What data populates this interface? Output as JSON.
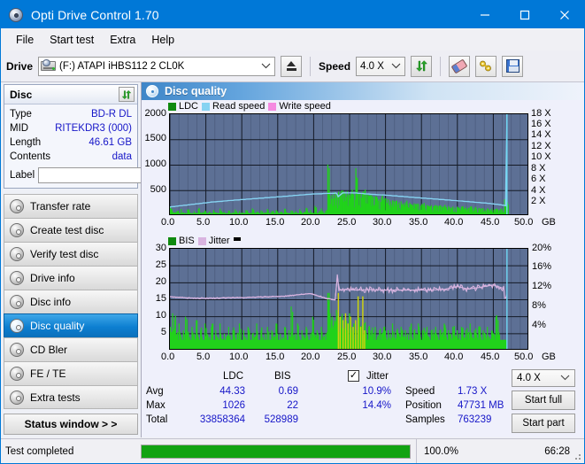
{
  "window": {
    "title": "Opti Drive Control 1.70",
    "icon": "disc-icon",
    "minimize": "–",
    "maximize": "□",
    "close": "✕"
  },
  "menu": {
    "items": [
      {
        "label": "File",
        "name": "menu-file"
      },
      {
        "label": "Start test",
        "name": "menu-start-test"
      },
      {
        "label": "Extra",
        "name": "menu-extra"
      },
      {
        "label": "Help",
        "name": "menu-help"
      }
    ]
  },
  "toolbar": {
    "drive_label": "Drive",
    "drive_value": "(F:)   ATAPI iHBS112  2 CL0K",
    "eject_title": "Eject",
    "speed_label": "Speed",
    "speed_value": "4.0 X",
    "refresh_title": "Refresh",
    "erase_title": "Erase",
    "tools_title": "Tools",
    "save_title": "Save"
  },
  "disc_panel": {
    "title": "Disc",
    "refresh_title": "Refresh disc info",
    "rows": [
      {
        "label": "Type",
        "value": "BD-R DL"
      },
      {
        "label": "MID",
        "value": "RITEKDR3 (000)"
      },
      {
        "label": "Length",
        "value": "46.61 GB"
      },
      {
        "label": "Contents",
        "value": "data"
      }
    ],
    "label_field_label": "Label",
    "label_field_value": "",
    "label_field_placeholder": "",
    "label_button_title": "Disc label"
  },
  "nav": {
    "items": [
      {
        "label": "Transfer rate",
        "name": "sidebar-item-transfer-rate",
        "active": false
      },
      {
        "label": "Create test disc",
        "name": "sidebar-item-create-test-disc",
        "active": false
      },
      {
        "label": "Verify test disc",
        "name": "sidebar-item-verify-test-disc",
        "active": false
      },
      {
        "label": "Drive info",
        "name": "sidebar-item-drive-info",
        "active": false
      },
      {
        "label": "Disc info",
        "name": "sidebar-item-disc-info",
        "active": false
      },
      {
        "label": "Disc quality",
        "name": "sidebar-item-disc-quality",
        "active": true
      },
      {
        "label": "CD Bler",
        "name": "sidebar-item-cd-bler",
        "active": false
      },
      {
        "label": "FE / TE",
        "name": "sidebar-item-fe-te",
        "active": false
      },
      {
        "label": "Extra tests",
        "name": "sidebar-item-extra-tests",
        "active": false
      }
    ],
    "status_window": "Status window > >"
  },
  "content": {
    "title": "Disc quality"
  },
  "stats": {
    "col_ldc": "LDC",
    "col_bis": "BIS",
    "jitter_label": "Jitter",
    "jitter_checked": true,
    "row_avg": "Avg",
    "row_max": "Max",
    "row_total": "Total",
    "ldc_avg": "44.33",
    "ldc_max": "1026",
    "ldc_total": "33858364",
    "bis_avg": "0.69",
    "bis_max": "22",
    "bis_total": "528989",
    "jitter_avg": "10.9%",
    "jitter_max": "14.4%",
    "speed_label": "Speed",
    "speed_value": "1.73 X",
    "position_label": "Position",
    "position_value": "47731 MB",
    "samples_label": "Samples",
    "samples_value": "763239",
    "speed_select": "4.0 X",
    "start_full": "Start full",
    "start_part": "Start part"
  },
  "statusbar": {
    "text": "Test completed",
    "progress_percent": 100.0,
    "percent_label": "100.0%",
    "elapsed": "66:28"
  },
  "colors": {
    "accent": "#0078d7",
    "plot_bg": "#5d7095",
    "grid": "#2b3347",
    "ldc_green": "#21d21b",
    "bis_green": "#21d21b",
    "read_speed": "#86d3f2",
    "write_speed": "#f58be0",
    "jitter": "#d9b4e0",
    "value_blue": "#1616c8",
    "progress_green": "#12a312"
  },
  "chart_data": [
    {
      "type": "area",
      "name": "ldc-chart",
      "title": "",
      "xlabel": "GB",
      "ylabel": "",
      "xlim": [
        0,
        50
      ],
      "ylim": [
        0,
        2000
      ],
      "y2lim": [
        0,
        18
      ],
      "y2label": "X",
      "grid": true,
      "legend": [
        "LDC",
        "Read speed",
        "Write speed"
      ],
      "legend_colors": [
        "#0f8a0f",
        "#86d3f2",
        "#f58be0"
      ],
      "xticks": [
        "0.0",
        "5.0",
        "10.0",
        "15.0",
        "20.0",
        "25.0",
        "30.0",
        "35.0",
        "40.0",
        "45.0",
        "50.0"
      ],
      "yticks": [
        "2000",
        "1500",
        "1000",
        "500"
      ],
      "y2ticks": [
        "18 X",
        "16 X",
        "14 X",
        "12 X",
        "10 X",
        "8 X",
        "6 X",
        "4 X",
        "2 X"
      ],
      "series": [
        {
          "name": "LDC",
          "kind": "bars",
          "x": [
            0.0,
            0.3,
            0.6,
            0.9,
            1.2,
            1.5,
            1.8,
            2.1,
            2.4,
            2.7,
            3.0,
            3.3,
            3.6,
            3.9,
            4.2,
            4.5,
            4.8,
            5.1,
            5.4,
            5.7,
            6.0,
            6.3,
            6.6,
            6.9,
            7.2,
            7.5,
            7.8,
            8.1,
            8.4,
            8.7,
            9.0,
            9.3,
            9.6,
            9.9,
            10.2,
            10.5,
            10.8,
            11.1,
            11.4,
            11.7,
            12.0,
            12.3,
            12.6,
            12.9,
            13.2,
            13.5,
            13.8,
            14.1,
            14.4,
            14.7,
            15.0,
            15.3,
            15.6,
            15.9,
            16.2,
            16.5,
            16.8,
            17.1,
            17.4,
            17.7,
            18.0,
            18.3,
            18.6,
            18.9,
            19.2,
            19.5,
            19.8,
            20.1,
            20.4,
            20.7,
            21.0,
            21.3,
            21.6,
            21.9,
            22.2,
            22.5,
            22.8,
            23.1,
            23.4,
            23.7,
            24.0,
            24.3,
            24.6,
            24.9,
            25.2,
            25.5,
            25.8,
            26.1,
            26.4,
            26.7,
            27.0,
            27.3,
            27.6,
            27.9,
            28.2,
            28.5,
            28.8,
            29.1,
            29.4,
            29.7,
            30.0,
            30.3,
            30.6,
            30.9,
            31.2,
            31.5,
            31.8,
            32.1,
            32.4,
            32.7,
            33.0,
            33.3,
            33.6,
            33.9,
            34.2,
            34.5,
            34.8,
            35.1,
            35.4,
            35.7,
            36.0,
            36.3,
            36.6,
            36.9,
            37.2,
            37.5,
            37.8,
            38.1,
            38.4,
            38.7,
            39.0,
            39.3,
            39.6,
            39.9,
            40.2,
            40.5,
            40.8,
            41.1,
            41.4,
            41.7,
            42.0,
            42.3,
            42.6,
            42.9,
            43.2,
            43.5,
            43.8,
            44.1,
            44.4,
            44.7,
            45.0,
            45.3,
            45.6,
            45.9,
            46.2,
            46.5,
            46.8
          ],
          "values": [
            180,
            90,
            70,
            95,
            60,
            140,
            75,
            60,
            130,
            70,
            55,
            95,
            65,
            140,
            60,
            75,
            110,
            60,
            90,
            55,
            120,
            70,
            60,
            145,
            65,
            80,
            60,
            105,
            55,
            75,
            130,
            60,
            95,
            65,
            55,
            120,
            70,
            60,
            150,
            65,
            85,
            55,
            110,
            60,
            75,
            140,
            60,
            95,
            65,
            120,
            55,
            80,
            60,
            145,
            70,
            60,
            110,
            65,
            90,
            55,
            135,
            60,
            75,
            160,
            65,
            120,
            70,
            200,
            60,
            95,
            150,
            65,
            110,
            1010,
            400,
            420,
            470,
            430,
            480,
            460,
            500,
            440,
            490,
            430,
            470,
            420,
            940,
            430,
            460,
            440,
            480,
            420,
            400,
            430,
            370,
            390,
            350,
            330,
            370,
            310,
            350,
            330,
            290,
            310,
            280,
            300,
            270,
            290,
            250,
            270,
            240,
            260,
            230,
            250,
            220,
            240,
            210,
            230,
            200,
            220,
            195,
            215,
            190,
            210,
            185,
            205,
            180,
            200,
            175,
            195,
            170,
            190,
            165,
            185,
            160,
            180,
            155,
            175,
            150,
            170,
            145,
            165,
            140,
            160,
            135,
            155,
            130,
            150,
            125,
            145,
            120,
            140,
            115,
            135,
            110,
            330,
            250
          ],
          "color": "#21d21b"
        },
        {
          "name": "Read speed",
          "kind": "line",
          "x": [
            0.0,
            2.0,
            4.0,
            6.0,
            8.0,
            10.0,
            12.0,
            14.0,
            16.0,
            18.0,
            20.0,
            22.0,
            23.2,
            23.4,
            24.0,
            26.0,
            28.0,
            30.0,
            32.0,
            34.0,
            36.0,
            38.0,
            40.0,
            42.0,
            44.0,
            46.0,
            46.8,
            46.9,
            46.9
          ],
          "values": [
            1.6,
            1.9,
            2.2,
            2.5,
            2.7,
            2.9,
            3.1,
            3.3,
            3.5,
            3.7,
            3.9,
            4.0,
            4.05,
            3.4,
            4.1,
            4.05,
            3.85,
            3.7,
            3.5,
            3.3,
            3.1,
            2.9,
            2.7,
            2.5,
            2.3,
            2.0,
            1.8,
            18.0,
            0.0
          ],
          "axis": "y2",
          "color": "#86d3f2"
        }
      ],
      "marker_line_x": 46.9
    },
    {
      "type": "area",
      "name": "bis-jitter-chart",
      "title": "",
      "xlabel": "GB",
      "ylabel": "",
      "xlim": [
        0,
        50
      ],
      "ylim": [
        0,
        30
      ],
      "y2lim": [
        0,
        20
      ],
      "y2label": "%",
      "grid": true,
      "legend": [
        "BIS",
        "Jitter"
      ],
      "legend_colors": [
        "#0f8a0f",
        "#d9b4e0"
      ],
      "xticks": [
        "0.0",
        "5.0",
        "10.0",
        "15.0",
        "20.0",
        "25.0",
        "30.0",
        "35.0",
        "40.0",
        "45.0",
        "50.0"
      ],
      "yticks": [
        "30",
        "25",
        "20",
        "15",
        "10",
        "5"
      ],
      "y2ticks": [
        "20%",
        "16%",
        "12%",
        "8%",
        "4%"
      ],
      "series": [
        {
          "name": "BIS",
          "kind": "bars",
          "color": "#21d21b",
          "x": [
            0.0,
            0.3,
            0.6,
            0.9,
            1.2,
            1.5,
            1.8,
            2.1,
            2.4,
            2.7,
            3.0,
            3.3,
            3.6,
            3.9,
            4.2,
            4.5,
            4.8,
            5.1,
            5.4,
            5.7,
            6.0,
            6.3,
            6.6,
            6.9,
            7.2,
            7.5,
            7.8,
            8.1,
            8.4,
            8.7,
            9.0,
            9.3,
            9.6,
            9.9,
            10.2,
            10.5,
            10.8,
            11.1,
            11.4,
            11.7,
            12.0,
            12.3,
            12.6,
            12.9,
            13.2,
            13.5,
            13.8,
            14.1,
            14.4,
            14.7,
            15.0,
            15.3,
            15.6,
            15.9,
            16.2,
            16.5,
            16.8,
            17.1,
            17.4,
            17.7,
            18.0,
            18.3,
            18.6,
            18.9,
            19.2,
            19.5,
            19.8,
            20.1,
            20.4,
            20.7,
            21.0,
            21.3,
            21.6,
            21.9,
            22.2,
            22.5,
            22.8,
            23.1,
            23.4,
            23.7,
            24.0,
            24.3,
            24.6,
            24.9,
            25.2,
            25.5,
            25.8,
            26.1,
            26.4,
            26.7,
            27.0,
            27.3,
            27.6,
            27.9,
            28.2,
            28.5,
            28.8,
            29.1,
            29.4,
            29.7,
            30.0,
            30.3,
            30.6,
            30.9,
            31.2,
            31.5,
            31.8,
            32.1,
            32.4,
            32.7,
            33.0,
            33.3,
            33.6,
            33.9,
            34.2,
            34.5,
            34.8,
            35.1,
            35.4,
            35.7,
            36.0,
            36.3,
            36.6,
            36.9,
            37.2,
            37.5,
            37.8,
            38.1,
            38.4,
            38.7,
            39.0,
            39.3,
            39.6,
            39.9,
            40.2,
            40.5,
            40.8,
            41.1,
            41.4,
            41.7,
            42.0,
            42.3,
            42.6,
            42.9,
            43.2,
            43.5,
            43.8,
            44.1,
            44.4,
            44.7,
            45.0,
            45.3,
            45.6,
            45.9,
            46.2,
            46.5,
            46.8
          ],
          "values": [
            7,
            11,
            9,
            5,
            8,
            4,
            6,
            10,
            5,
            4,
            7,
            5,
            9,
            4,
            6,
            3,
            8,
            5,
            4,
            7,
            3,
            6,
            4,
            8,
            3,
            5,
            4,
            7,
            3,
            6,
            4,
            5,
            8,
            3,
            6,
            4,
            7,
            3,
            5,
            4,
            8,
            3,
            6,
            4,
            5,
            7,
            3,
            6,
            4,
            8,
            3,
            5,
            4,
            7,
            3,
            6,
            13,
            4,
            5,
            8,
            3,
            6,
            4,
            7,
            3,
            5,
            10,
            4,
            6,
            3,
            7,
            4,
            5,
            17,
            11,
            10,
            9,
            12,
            8,
            10,
            7,
            9,
            6,
            11,
            7,
            8,
            6,
            16,
            7,
            6,
            8,
            5,
            7,
            6,
            5,
            7,
            4,
            6,
            5,
            7,
            4,
            6,
            5,
            8,
            4,
            6,
            5,
            7,
            4,
            6,
            5,
            7,
            4,
            6,
            5,
            8,
            4,
            6,
            5,
            7,
            4,
            6,
            5,
            7,
            4,
            6,
            5,
            8,
            4,
            6,
            5,
            7,
            4,
            6,
            5,
            7,
            4,
            6,
            5,
            8,
            4,
            6,
            5,
            7,
            4,
            6,
            5,
            7,
            4,
            6,
            5,
            10,
            9
          ]
        },
        {
          "name": "Jitter",
          "kind": "line",
          "color": "#d9b4e0",
          "axis": "y2",
          "x": [
            0.0,
            2.0,
            4.0,
            6.0,
            8.0,
            10.0,
            12.0,
            14.0,
            16.0,
            18.0,
            19.5,
            21.0,
            22.0,
            23.0,
            23.3,
            23.5,
            24.0,
            26.0,
            28.0,
            30.0,
            32.0,
            34.0,
            36.0,
            38.0,
            40.0,
            41.5,
            43.0,
            45.0,
            46.5
          ],
          "values": [
            10.6,
            10.4,
            10.3,
            10.3,
            10.4,
            10.4,
            10.5,
            10.6,
            10.7,
            11.0,
            11.2,
            10.6,
            10.2,
            10.0,
            14.7,
            11.8,
            12.0,
            11.9,
            12.0,
            11.9,
            11.9,
            11.9,
            11.9,
            12.0,
            12.6,
            12.1,
            12.4,
            12.9,
            12.2
          ]
        }
      ],
      "marker_line_x": 46.9
    }
  ]
}
